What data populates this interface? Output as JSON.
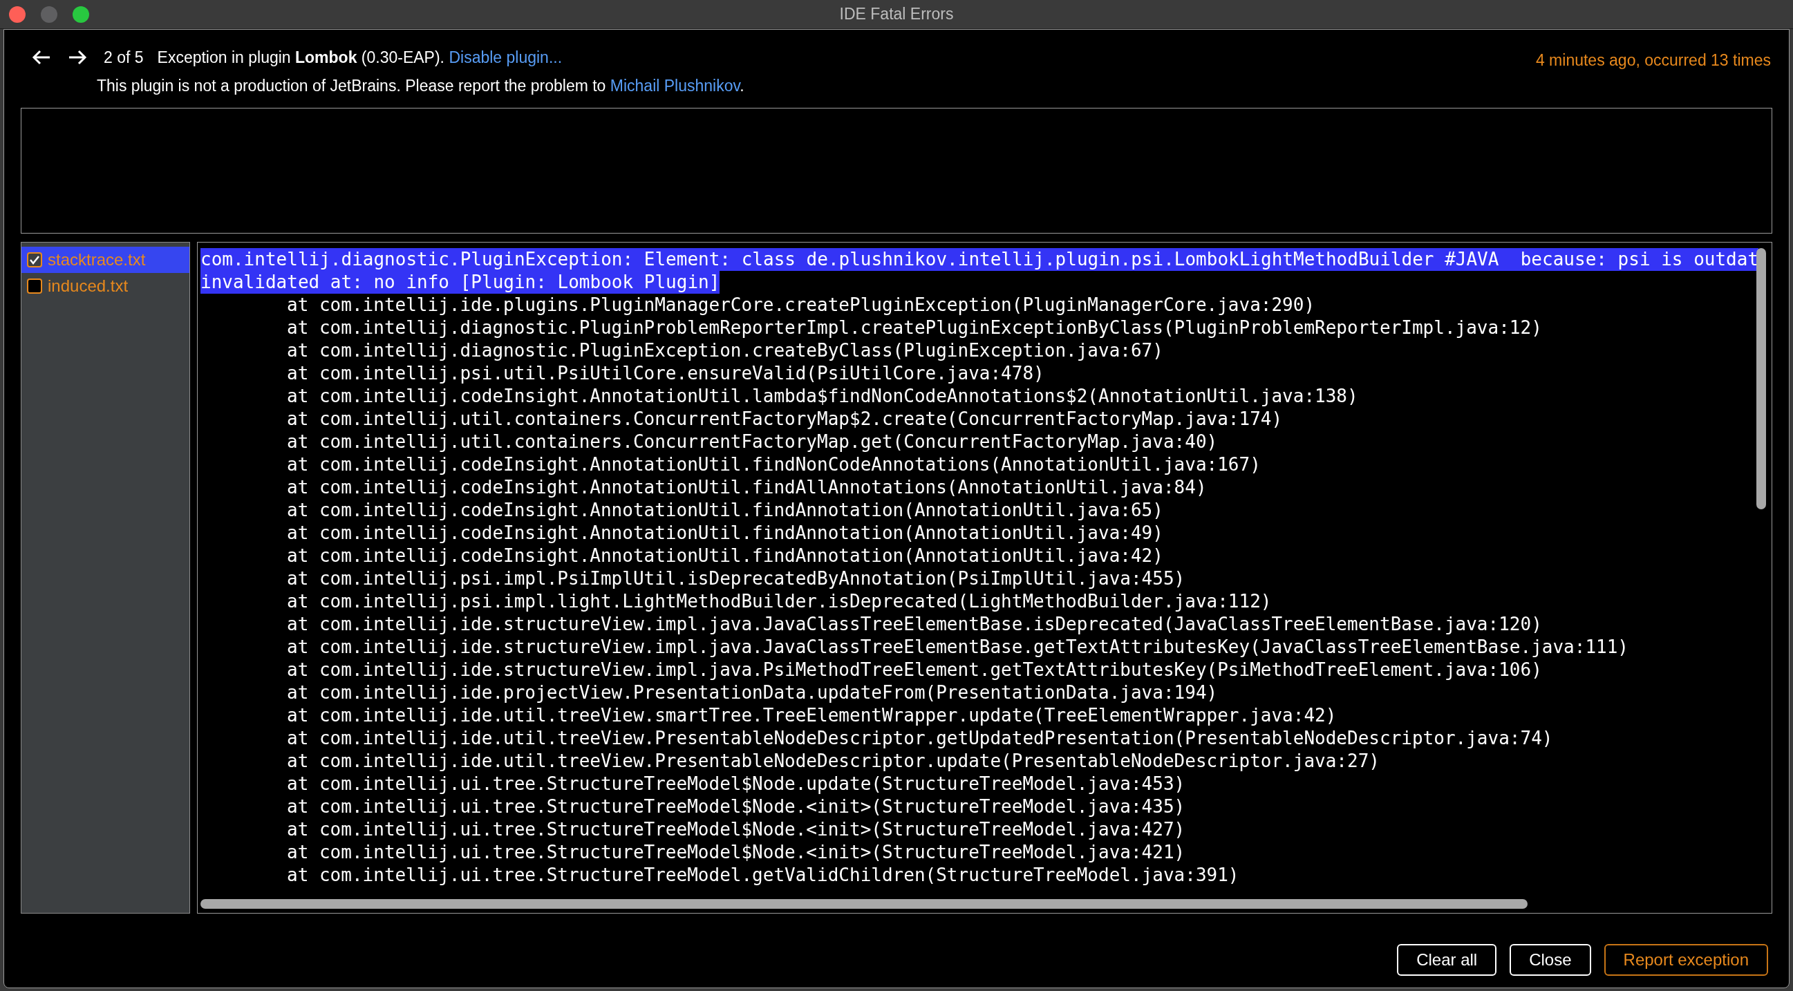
{
  "window": {
    "title": "IDE Fatal Errors"
  },
  "header": {
    "position": "2 of 5",
    "message": "Exception in plugin **Lombok** (0.30-EAP).",
    "disable_link": "Disable plugin...",
    "timestamp": "4 minutes ago, occurred 13 times",
    "notice": {
      "text": "This plugin is not a production of JetBrains. Please report the problem to",
      "link": "Michail Plushnikov",
      "end": "."
    }
  },
  "attachments": [
    {
      "label": "stacktrace.txt",
      "checked": true,
      "selected": true
    },
    {
      "label": "induced.txt",
      "checked": false,
      "selected": false
    }
  ],
  "trace_lines": [
    {
      "kind": "message",
      "selected": true,
      "text": "com.intellij.diagnostic.PluginException: Element: class de.plushnikov.intellij.plugin.psi.LombokLightMethodBuilder #JAVA  because: psi is outdat"
    },
    {
      "kind": "message",
      "selected": true,
      "text": "invalidated at: no info [Plugin: Lombook Plugin]"
    },
    {
      "kind": "frame",
      "selected": false,
      "text": "at com.intellij.ide.plugins.PluginManagerCore.createPluginException(PluginManagerCore.java:290)"
    },
    {
      "kind": "frame",
      "selected": false,
      "text": "at com.intellij.diagnostic.PluginProblemReporterImpl.createPluginExceptionByClass(PluginProblemReporterImpl.java:12)"
    },
    {
      "kind": "frame",
      "selected": false,
      "text": "at com.intellij.diagnostic.PluginException.createByClass(PluginException.java:67)"
    },
    {
      "kind": "frame",
      "selected": false,
      "text": "at com.intellij.psi.util.PsiUtilCore.ensureValid(PsiUtilCore.java:478)"
    },
    {
      "kind": "frame",
      "selected": false,
      "text": "at com.intellij.codeInsight.AnnotationUtil.lambda$findNonCodeAnnotations$2(AnnotationUtil.java:138)"
    },
    {
      "kind": "frame",
      "selected": false,
      "text": "at com.intellij.util.containers.ConcurrentFactoryMap$2.create(ConcurrentFactoryMap.java:174)"
    },
    {
      "kind": "frame",
      "selected": false,
      "text": "at com.intellij.util.containers.ConcurrentFactoryMap.get(ConcurrentFactoryMap.java:40)"
    },
    {
      "kind": "frame",
      "selected": false,
      "text": "at com.intellij.codeInsight.AnnotationUtil.findNonCodeAnnotations(AnnotationUtil.java:167)"
    },
    {
      "kind": "frame",
      "selected": false,
      "text": "at com.intellij.codeInsight.AnnotationUtil.findAllAnnotations(AnnotationUtil.java:84)"
    },
    {
      "kind": "frame",
      "selected": false,
      "text": "at com.intellij.codeInsight.AnnotationUtil.findAnnotation(AnnotationUtil.java:65)"
    },
    {
      "kind": "frame",
      "selected": false,
      "text": "at com.intellij.codeInsight.AnnotationUtil.findAnnotation(AnnotationUtil.java:49)"
    },
    {
      "kind": "frame",
      "selected": false,
      "text": "at com.intellij.codeInsight.AnnotationUtil.findAnnotation(AnnotationUtil.java:42)"
    },
    {
      "kind": "frame",
      "selected": false,
      "text": "at com.intellij.psi.impl.PsiImplUtil.isDeprecatedByAnnotation(PsiImplUtil.java:455)"
    },
    {
      "kind": "frame",
      "selected": false,
      "text": "at com.intellij.psi.impl.light.LightMethodBuilder.isDeprecated(LightMethodBuilder.java:112)"
    },
    {
      "kind": "frame",
      "selected": false,
      "text": "at com.intellij.ide.structureView.impl.java.JavaClassTreeElementBase.isDeprecated(JavaClassTreeElementBase.java:120)"
    },
    {
      "kind": "frame",
      "selected": false,
      "text": "at com.intellij.ide.structureView.impl.java.JavaClassTreeElementBase.getTextAttributesKey(JavaClassTreeElementBase.java:111)"
    },
    {
      "kind": "frame",
      "selected": false,
      "text": "at com.intellij.ide.structureView.impl.java.PsiMethodTreeElement.getTextAttributesKey(PsiMethodTreeElement.java:106)"
    },
    {
      "kind": "frame",
      "selected": false,
      "text": "at com.intellij.ide.projectView.PresentationData.updateFrom(PresentationData.java:194)"
    },
    {
      "kind": "frame",
      "selected": false,
      "text": "at com.intellij.ide.util.treeView.smartTree.TreeElementWrapper.update(TreeElementWrapper.java:42)"
    },
    {
      "kind": "frame",
      "selected": false,
      "text": "at com.intellij.ide.util.treeView.PresentableNodeDescriptor.getUpdatedPresentation(PresentableNodeDescriptor.java:74)"
    },
    {
      "kind": "frame",
      "selected": false,
      "text": "at com.intellij.ide.util.treeView.PresentableNodeDescriptor.update(PresentableNodeDescriptor.java:27)"
    },
    {
      "kind": "frame",
      "selected": false,
      "text": "at com.intellij.ui.tree.StructureTreeModel$Node.update(StructureTreeModel.java:453)"
    },
    {
      "kind": "frame",
      "selected": false,
      "text": "at com.intellij.ui.tree.StructureTreeModel$Node.<init>(StructureTreeModel.java:435)"
    },
    {
      "kind": "frame",
      "selected": false,
      "text": "at com.intellij.ui.tree.StructureTreeModel$Node.<init>(StructureTreeModel.java:427)"
    },
    {
      "kind": "frame",
      "selected": false,
      "text": "at com.intellij.ui.tree.StructureTreeModel$Node.<init>(StructureTreeModel.java:421)"
    },
    {
      "kind": "frame",
      "selected": false,
      "text": "at com.intellij.ui.tree.StructureTreeModel.getValidChildren(StructureTreeModel.java:391)"
    }
  ],
  "buttons": [
    {
      "label": "Clear all",
      "kind": "normal"
    },
    {
      "label": "Close",
      "kind": "normal"
    },
    {
      "label": "Report exception",
      "kind": "primary"
    }
  ]
}
